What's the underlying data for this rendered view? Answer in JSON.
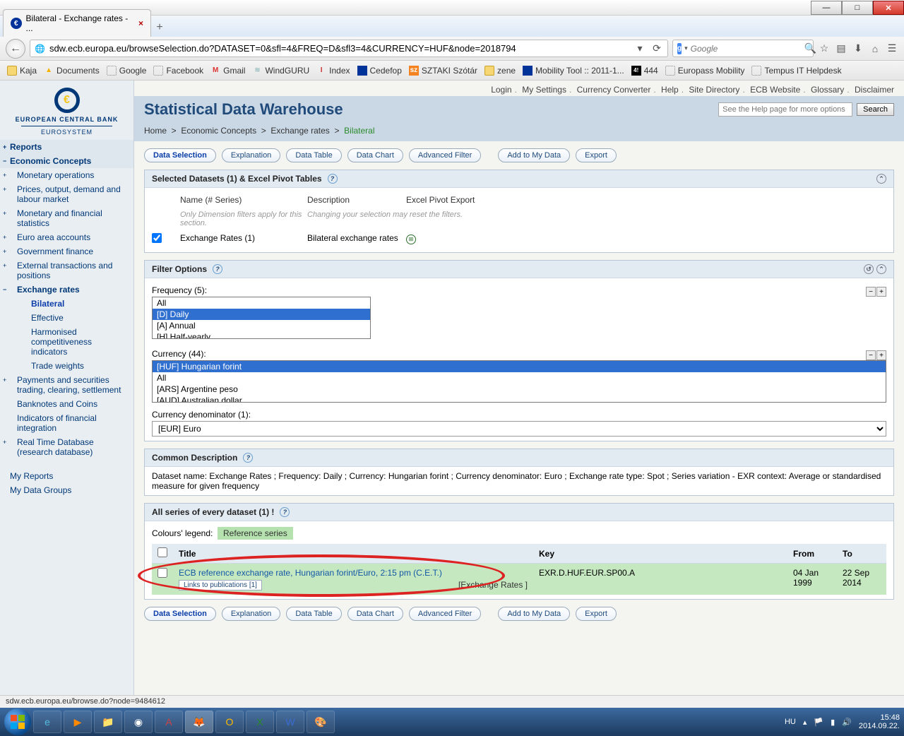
{
  "window": {
    "tab_title": "Bilateral - Exchange rates - ...",
    "url": "sdw.ecb.europa.eu/browseSelection.do?DATASET=0&sfl=4&FREQ=D&sfl3=4&CURRENCY=HUF&node=2018794",
    "search_placeholder": "Google",
    "status": "sdw.ecb.europa.eu/browse.do?node=9484612"
  },
  "bookmarks": [
    "Kaja",
    "Documents",
    "Google",
    "Facebook",
    "Gmail",
    "WindGURU",
    "Index",
    "Cedefop",
    "SZTAKI Szótár",
    "zene",
    "Mobility Tool :: 2011-1...",
    "444",
    "Europass Mobility",
    "Tempus IT Helpdesk"
  ],
  "top_links": [
    "Login",
    "My Settings",
    "Currency Converter",
    "Help",
    "Site Directory",
    "ECB Website",
    "Glossary",
    "Disclaimer"
  ],
  "header": {
    "title": "Statistical Data Warehouse",
    "help_placeholder": "See the Help page for more options",
    "search_btn": "Search"
  },
  "breadcrumb": {
    "home": "Home",
    "l1": "Economic Concepts",
    "l2": "Exchange rates",
    "cur": "Bilateral"
  },
  "logo": {
    "line1": "EUROPEAN CENTRAL BANK",
    "line2": "EUROSYSTEM"
  },
  "nav": {
    "reports": "Reports",
    "concepts": "Economic Concepts",
    "items": [
      "Monetary operations",
      "Prices, output, demand and labour market",
      "Monetary and financial statistics",
      "Euro area accounts",
      "Government finance",
      "External transactions and positions"
    ],
    "xr": "Exchange rates",
    "xr_items": [
      "Bilateral",
      "Effective",
      "Harmonised competitiveness indicators",
      "Trade weights"
    ],
    "tail": [
      "Payments and securities trading, clearing, settlement",
      "Banknotes and Coins",
      "Indicators of financial integration",
      "Real Time Database (research database)"
    ],
    "myreports": "My Reports",
    "mygroups": "My Data Groups"
  },
  "tabs": [
    "Data Selection",
    "Explanation",
    "Data Table",
    "Data Chart",
    "Advanced Filter",
    "Add to My Data",
    "Export"
  ],
  "datasets": {
    "head": "Selected Datasets (1) & Excel Pivot Tables",
    "col_name": "Name (# Series)",
    "col_desc": "Description",
    "col_excel": "Excel Pivot Export",
    "note1": "Only Dimension filters apply for this section.",
    "note2": "Changing your selection may reset the filters.",
    "row_name": "Exchange Rates  (1)",
    "row_desc": "Bilateral exchange rates"
  },
  "filters": {
    "head": "Filter Options",
    "freq_label": "Frequency (5):",
    "freq_opts": [
      "All",
      "[D] Daily",
      "[A] Annual",
      "[H] Half-yearly"
    ],
    "cur_label": "Currency  (44):",
    "cur_opts": [
      "[HUF] Hungarian forint",
      "All",
      "[ARS] Argentine peso",
      "[AUD] Australian dollar"
    ],
    "denom_label": "Currency denominator  (1):",
    "denom_val": "[EUR] Euro"
  },
  "common": {
    "head": "Common Description",
    "text": "Dataset name: Exchange Rates ; Frequency: Daily ; Currency: Hungarian forint ; Currency denominator: Euro ; Exchange rate type: Spot ; Series variation - EXR context: Average or standardised measure for given frequency"
  },
  "series": {
    "head": "All series of every dataset (1) !",
    "legend_label": "Colours' legend:",
    "legend_ref": "Reference series",
    "col_title": "Title",
    "col_key": "Key",
    "col_from": "From",
    "col_to": "To",
    "row_title": "ECB reference exchange rate, Hungarian forint/Euro, 2:15 pm (C.E.T.)",
    "row_pub": "Links to publications [1]",
    "row_src": "[Exchange Rates ]",
    "row_key": "EXR.D.HUF.EUR.SP00.A",
    "row_from": "04 Jan 1999",
    "row_to": "22 Sep 2014"
  },
  "taskbar": {
    "lang": "HU",
    "time": "15:48",
    "date": "2014.09.22."
  }
}
